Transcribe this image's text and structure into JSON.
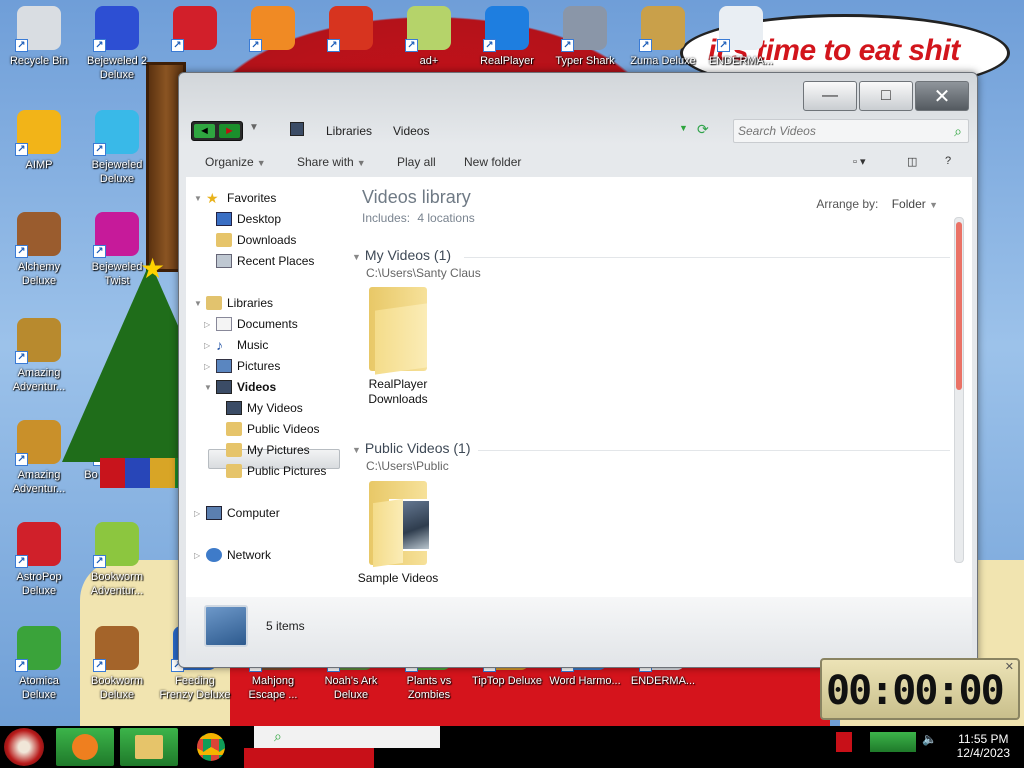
{
  "wallpaper": {
    "speech_text": "it's time to eat shit"
  },
  "desktop_icons": [
    {
      "name": "recycle-bin-icon",
      "label": "Recycle Bin",
      "color": "#d9dde2"
    },
    {
      "name": "bejeweled-2-deluxe-icon",
      "label": "Bejeweled 2 Deluxe",
      "color": "#2d4fd3"
    },
    {
      "name": "puffle-icon",
      "label": "",
      "color": "#d21f2a"
    },
    {
      "name": "firefox-icon",
      "label": "",
      "color": "#f08a24"
    },
    {
      "name": "torii-icon",
      "label": "",
      "color": "#d7341f"
    },
    {
      "name": "notepad-plus-icon",
      "label": "ad+",
      "color": "#b5d36a"
    },
    {
      "name": "realplayer-icon",
      "label": "RealPlayer",
      "color": "#1e7ee0"
    },
    {
      "name": "typer-shark-icon",
      "label": "Typer Shark",
      "color": "#8a96a8"
    },
    {
      "name": "zuma-deluxe-icon",
      "label": "Zuma Deluxe",
      "color": "#c9a04a"
    },
    {
      "name": "enderman-icon",
      "label": "ENDERMA...",
      "color": "#e9eef3"
    },
    {
      "name": "aimp-icon",
      "label": "AIMP",
      "color": "#f2b418"
    },
    {
      "name": "bejeweled-deluxe-icon",
      "label": "Bejeweled Deluxe",
      "color": "#39b9e8"
    },
    {
      "name": "alchemy-deluxe-icon",
      "label": "Alchemy Deluxe",
      "color": "#9a5c2e"
    },
    {
      "name": "bejeweled-twist-icon",
      "label": "Bejeweled Twist",
      "color": "#c61a9a"
    },
    {
      "name": "amazing-adventures-icon",
      "label": "Amazing Adventur...",
      "color": "#b88a2e"
    },
    {
      "name": "amazing-adventures-2-icon",
      "label": "Amazing Adventur...",
      "color": "#c9902a"
    },
    {
      "name": "bookstore-icon",
      "label": "Bo Booksto...",
      "color": "#8a5c2a"
    },
    {
      "name": "astropop-deluxe-icon",
      "label": "AstroPop Deluxe",
      "color": "#d0202a"
    },
    {
      "name": "bookworm-adventures-icon",
      "label": "Bookworm Adventur...",
      "color": "#8cc63f"
    },
    {
      "name": "atomica-deluxe-icon",
      "label": "Atomica Deluxe",
      "color": "#3aa33a"
    },
    {
      "name": "bookworm-deluxe-icon",
      "label": "Bookworm Deluxe",
      "color": "#a4642a"
    },
    {
      "name": "feeding-frenzy-icon",
      "label": "Feeding Frenzy Deluxe",
      "color": "#2a6ac9"
    },
    {
      "name": "mahjong-escape-icon",
      "label": "Mahjong Escape ...",
      "color": "#7a4a2a"
    },
    {
      "name": "noahs-ark-icon",
      "label": "Noah's Ark Deluxe",
      "color": "#5a8a3a"
    },
    {
      "name": "plants-vs-zombies-icon",
      "label": "Plants vs Zombies",
      "color": "#4caa3a"
    },
    {
      "name": "tiptop-deluxe-icon",
      "label": "TipTop Deluxe",
      "color": "#d89a2a"
    },
    {
      "name": "word-harmony-icon",
      "label": "Word Harmo...",
      "color": "#3a7ac9"
    },
    {
      "name": "enderman-2-icon",
      "label": "ENDERMA...",
      "color": "#e0e4ea"
    }
  ],
  "window": {
    "minimize": "—",
    "maximize": "□",
    "close": "✕",
    "nav": {
      "back": "◄",
      "forward": "►"
    },
    "breadcrumb": [
      "Libraries",
      "Videos"
    ],
    "search_placeholder": "Search Videos",
    "toolbar": {
      "organize": "Organize",
      "share_with": "Share with",
      "play_all": "Play all",
      "new_folder": "New folder",
      "help": "?"
    },
    "nav_pane": {
      "favorites": "Favorites",
      "desktop": "Desktop",
      "downloads": "Downloads",
      "recent_places": "Recent Places",
      "libraries": "Libraries",
      "documents": "Documents",
      "music": "Music",
      "pictures": "Pictures",
      "videos": "Videos",
      "my_videos": "My Videos",
      "public_videos": "Public Videos",
      "my_pictures": "My Pictures",
      "public_pictures": "Public Pictures",
      "computer": "Computer",
      "network": "Network"
    },
    "library": {
      "title": "Videos library",
      "includes_label": "Includes:",
      "includes_value": "4 locations",
      "arrange_by_label": "Arrange by:",
      "arrange_by_value": "Folder"
    },
    "groups": [
      {
        "title": "My Videos (1)",
        "path": "C:\\Users\\Santy Claus",
        "item": "RealPlayer Downloads"
      },
      {
        "title": "Public Videos (1)",
        "path": "C:\\Users\\Public",
        "item": "Sample Videos"
      }
    ],
    "details": {
      "count": "5 items"
    }
  },
  "clock_widget": {
    "time": "00:00:00"
  },
  "taskbar": {
    "time": "11:55 PM",
    "date": "12/4/2023"
  }
}
